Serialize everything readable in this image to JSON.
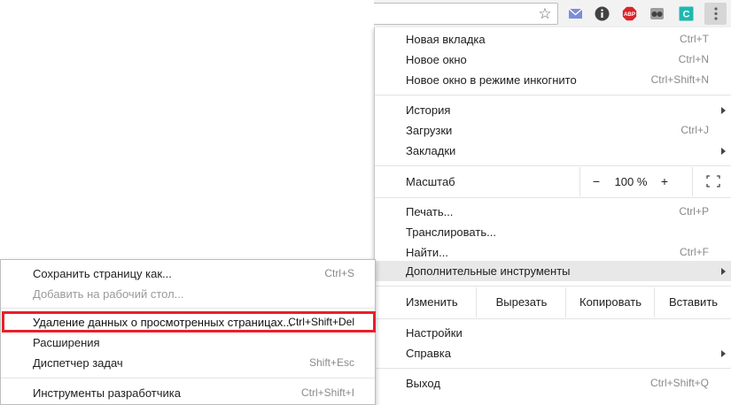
{
  "toolbar": {
    "bookmark_icon": "star-icon",
    "extensions": [
      {
        "name": "mail-icon",
        "color": "#7b8fd6"
      },
      {
        "name": "info-icon",
        "color": "#424242"
      },
      {
        "name": "adblock-plus-icon",
        "label": "ABP",
        "color": "#d8252b"
      },
      {
        "name": "extension-icon",
        "color": "#616161"
      },
      {
        "name": "c-extension-icon",
        "label": "C",
        "color": "#1fb8b0"
      }
    ],
    "menu_icon": "three-dots-vertical-icon"
  },
  "main_menu": {
    "items": [
      {
        "label": "Новая вкладка",
        "shortcut": "Ctrl+T"
      },
      {
        "label": "Новое окно",
        "shortcut": "Ctrl+N"
      },
      {
        "label": "Новое окно в режиме инкогнито",
        "shortcut": "Ctrl+Shift+N"
      },
      {
        "label": "История",
        "shortcut": ""
      },
      {
        "label": "Загрузки",
        "shortcut": "Ctrl+J"
      },
      {
        "label": "Закладки",
        "shortcut": ""
      },
      {
        "label": "Печать...",
        "shortcut": "Ctrl+P"
      },
      {
        "label": "Транслировать...",
        "shortcut": ""
      },
      {
        "label": "Найти...",
        "shortcut": "Ctrl+F"
      },
      {
        "label": "Дополнительные инструменты",
        "shortcut": ""
      },
      {
        "label": "Настройки",
        "shortcut": ""
      },
      {
        "label": "Справка",
        "shortcut": ""
      },
      {
        "label": "Выход",
        "shortcut": "Ctrl+Shift+Q"
      }
    ],
    "zoom": {
      "label": "Масштаб",
      "minus": "−",
      "value": "100 %",
      "plus": "+"
    },
    "edit": {
      "label": "Изменить",
      "cut": "Вырезать",
      "copy": "Копировать",
      "paste": "Вставить"
    }
  },
  "sub_menu": {
    "items": [
      {
        "label": "Сохранить страницу как...",
        "shortcut": "Ctrl+S"
      },
      {
        "label": "Добавить на рабочий стол...",
        "shortcut": ""
      },
      {
        "label": "Удаление данных о просмотренных страницах...",
        "shortcut": "Ctrl+Shift+Del"
      },
      {
        "label": "Расширения",
        "shortcut": ""
      },
      {
        "label": "Диспетчер задач",
        "shortcut": "Shift+Esc"
      },
      {
        "label": "Инструменты разработчика",
        "shortcut": "Ctrl+Shift+I"
      }
    ],
    "highlight_color": "#e8202a"
  }
}
